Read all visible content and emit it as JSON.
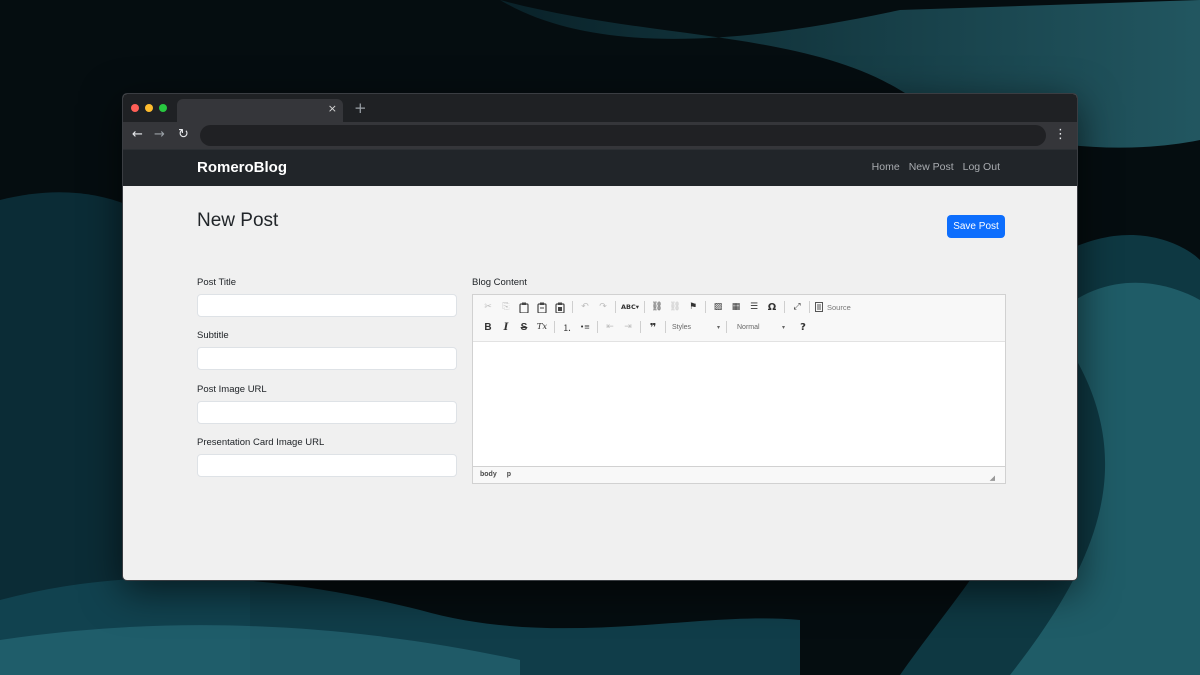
{
  "colors": {
    "navbar": "#212529",
    "page_bg": "#f0f0f0",
    "primary_button": "#0d6efd",
    "browser_frame": "#35363a"
  },
  "browser": {
    "tab_close": "×",
    "new_tab": "+",
    "back": "←",
    "forward": "→",
    "reload": "↻",
    "menu": "⋮"
  },
  "navbar": {
    "brand": "RomeroBlog",
    "links": [
      "Home",
      "New Post",
      "Log Out"
    ]
  },
  "page": {
    "title": "New Post",
    "save_button": "Save Post"
  },
  "form": {
    "fields": [
      {
        "label": "Post Title",
        "value": ""
      },
      {
        "label": "Subtitle",
        "value": ""
      },
      {
        "label": "Post Image URL",
        "value": ""
      },
      {
        "label": "Presentation Card Image URL",
        "value": ""
      }
    ],
    "content_label": "Blog Content"
  },
  "editor": {
    "toolbar_row1": [
      {
        "icon": "cut-icon",
        "glyph": "✂",
        "enabled": false
      },
      {
        "icon": "copy-icon",
        "glyph": "⎘",
        "enabled": false
      },
      {
        "icon": "paste-icon",
        "glyph": "📋",
        "enabled": true
      },
      {
        "icon": "paste-text-icon",
        "glyph": "📋",
        "enabled": true
      },
      {
        "icon": "paste-word-icon",
        "glyph": "📋",
        "enabled": true
      },
      {
        "icon": "undo-icon",
        "glyph": "↶",
        "enabled": false
      },
      {
        "icon": "redo-icon",
        "glyph": "↷",
        "enabled": false
      },
      {
        "icon": "spellcheck-icon",
        "glyph": "ABC▾",
        "enabled": true
      },
      {
        "icon": "link-icon",
        "glyph": "⛓",
        "enabled": true
      },
      {
        "icon": "unlink-icon",
        "glyph": "⛓",
        "enabled": false
      },
      {
        "icon": "anchor-icon",
        "glyph": "⚑",
        "enabled": true
      },
      {
        "icon": "image-icon",
        "glyph": "▨",
        "enabled": true
      },
      {
        "icon": "table-icon",
        "glyph": "▦",
        "enabled": true
      },
      {
        "icon": "horizontal-line-icon",
        "glyph": "☰",
        "enabled": true
      },
      {
        "icon": "special-char-icon",
        "glyph": "Ω",
        "enabled": true
      },
      {
        "icon": "maximize-icon",
        "glyph": "⤢",
        "enabled": true
      }
    ],
    "source_label": "Source",
    "toolbar_row2": [
      {
        "icon": "bold-icon",
        "glyph": "B"
      },
      {
        "icon": "italic-icon",
        "glyph": "I"
      },
      {
        "icon": "strike-icon",
        "glyph": "S"
      },
      {
        "icon": "remove-format-icon",
        "glyph": "Tx"
      },
      {
        "icon": "numbered-list-icon",
        "glyph": "⒈"
      },
      {
        "icon": "bulleted-list-icon",
        "glyph": "•≡"
      },
      {
        "icon": "outdent-icon",
        "glyph": "⇤"
      },
      {
        "icon": "indent-icon",
        "glyph": "⇥"
      },
      {
        "icon": "blockquote-icon",
        "glyph": "❞"
      }
    ],
    "styles_combo": "Styles",
    "format_combo": "Normal",
    "help": "?",
    "path": [
      "body",
      "p"
    ]
  }
}
